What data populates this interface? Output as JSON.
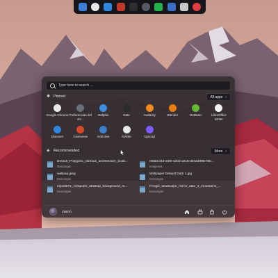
{
  "dock": {
    "icons": [
      {
        "name": "files",
        "color": "#3b7fd9"
      },
      {
        "name": "chrome",
        "color": "#e9e9e9"
      },
      {
        "name": "discover",
        "color": "#2e86de"
      },
      {
        "name": "image-viewer",
        "color": "#c0392b"
      },
      {
        "name": "terminal",
        "color": "#2d2d2d"
      },
      {
        "name": "settings",
        "color": "#555a64"
      },
      {
        "name": "green-app",
        "color": "#22b14c"
      },
      {
        "name": "store",
        "color": "#3a6fc4"
      },
      {
        "name": "kite",
        "color": "#c9c9c9"
      },
      {
        "name": "user-app",
        "color": "#e04040"
      }
    ]
  },
  "search": {
    "placeholder": "Type here to search ..."
  },
  "pinned": {
    "title": "Pinned",
    "all_apps_label": "All apps",
    "apps": [
      {
        "label": "Google Chrome",
        "icon": "chrome-icon",
        "color": "#e8e8e8"
      },
      {
        "label": "Preferencias del sis...",
        "icon": "preferences-icon",
        "color": "#6a6e78"
      },
      {
        "label": "Dolphin",
        "icon": "folder-icon",
        "color": "#3d8fe0"
      },
      {
        "label": "Kate",
        "icon": "kate-icon",
        "color": "#2b2b2b"
      },
      {
        "label": "Audacity",
        "icon": "audacity-icon",
        "color": "#f08a1c"
      },
      {
        "label": "Blender",
        "icon": "blender-icon",
        "color": "#e87d0d"
      },
      {
        "label": "G4Music",
        "icon": "music-icon",
        "color": "#62b832"
      },
      {
        "label": "LibreOffice Writer",
        "icon": "writer-icon",
        "color": "#f2f2f2"
      },
      {
        "label": "Discover",
        "icon": "discover-icon",
        "color": "#2e86de"
      },
      {
        "label": "Gwenview",
        "icon": "gwenview-icon",
        "color": "#d44a2a"
      },
      {
        "label": "Kdenlive",
        "icon": "kdenlive-icon",
        "color": "#3a7fc8"
      },
      {
        "label": "KWrite",
        "icon": "kwrite-icon",
        "color": "#e8e8e8"
      },
      {
        "label": "Upscayl",
        "icon": "upscayl-icon",
        "color": "#7a5cff"
      }
    ]
  },
  "recommended": {
    "title": "Recommended",
    "more_label": "More",
    "files": [
      {
        "name": "Default_Polygons_vitreous_architecture_build...",
        "folder": "Descargas"
      },
      {
        "name": "e55be443-24f0-4203-a4c8-d04a3f99e760...",
        "folder": "Imágenes"
      },
      {
        "name": "wallpap.jpeg",
        "folder": "Descargas"
      },
      {
        "name": "Wallpaper Default Dark 1.jpg",
        "folder": "Descargas"
      },
      {
        "name": "ezpz5872_computer_desktop_background_m...",
        "folder": "Descargas"
      },
      {
        "name": "FAngie_landscape_mirror_lake_3_mountains_...",
        "folder": "Descargas"
      }
    ]
  },
  "user": {
    "name": "zaron"
  }
}
